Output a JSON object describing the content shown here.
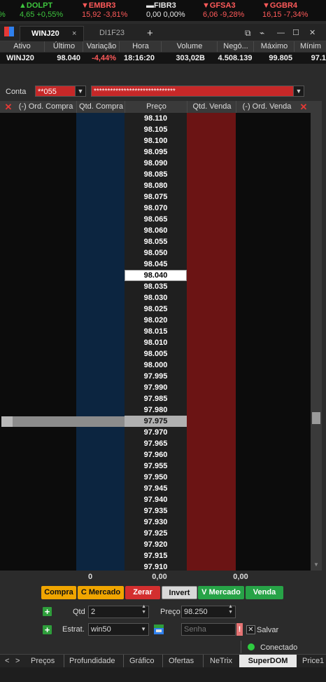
{
  "ticker": [
    {
      "arrow": "▲",
      "name": "DOLPT",
      "value": "4,65",
      "change": "+0,55%",
      "dir": "up",
      "prefix": "%"
    },
    {
      "arrow": "▼",
      "name": "EMBR3",
      "value": "15,92",
      "change": "-3,81%",
      "dir": "dn"
    },
    {
      "arrow": "▬",
      "name": "FIBR3",
      "value": "0,00",
      "change": "0,00%",
      "dir": "nt"
    },
    {
      "arrow": "▼",
      "name": "GFSA3",
      "value": "6,06",
      "change": "-9,28%",
      "dir": "dn"
    },
    {
      "arrow": "▼",
      "name": "GGBR4",
      "value": "16,15",
      "change": "-7,34%",
      "dir": "dn"
    }
  ],
  "tabs": {
    "active": "WINJ20",
    "other": "DI1F23",
    "close": "×",
    "add": "+"
  },
  "window_controls": {
    "detach": "⧉",
    "chart": "⌁",
    "minimize": "—",
    "maximize": "☐",
    "close": "✕"
  },
  "quote_headers": [
    "Ativo",
    "Último",
    "Variação",
    "Hora",
    "Volume",
    "Negó...",
    "Máximo",
    "Mínim"
  ],
  "quote_row": [
    "WINJ20",
    "98.040",
    "-4,44%",
    "18:16:20",
    "303,02B",
    "4.508.139",
    "99.805",
    "97.1"
  ],
  "conta": {
    "label": "Conta",
    "account": "**055",
    "name": "******************************"
  },
  "ladder_headers": {
    "ord_compra": "(-) Ord. Compra",
    "qtd_compra": "Qtd. Compra",
    "preco": "Preço",
    "qtd_venda": "Qtd. Venda",
    "ord_venda": "(-) Ord. Venda",
    "close": "✕"
  },
  "prices": [
    "98.110",
    "98.105",
    "98.100",
    "98.095",
    "98.090",
    "98.085",
    "98.080",
    "98.075",
    "98.070",
    "98.065",
    "98.060",
    "98.055",
    "98.050",
    "98.045",
    "98.040",
    "98.035",
    "98.030",
    "98.025",
    "98.020",
    "98.015",
    "98.010",
    "98.005",
    "98.000",
    "97.995",
    "97.990",
    "97.985",
    "97.980",
    "97.975",
    "97.970",
    "97.965",
    "97.960",
    "97.955",
    "97.950",
    "97.945",
    "97.940",
    "97.935",
    "97.930",
    "97.925",
    "97.920",
    "97.915",
    "97.910"
  ],
  "current_price": "98.040",
  "selected_price": "97.975",
  "totals": {
    "ord_compra": "0",
    "qtd_compra": "0,00",
    "qtd_venda": "0,00"
  },
  "buttons": {
    "compra": "Compra",
    "c_mercado": "C Mercado",
    "zerar": "Zerar",
    "invert": "Invert",
    "v_mercado": "V Mercado",
    "venda": "Venda"
  },
  "form": {
    "qtd_label": "Qtd",
    "qtd_value": "2",
    "preco_label": "Preço",
    "preco_value": "98.250",
    "estrat_label": "Estrat.",
    "estrat_value": "win50",
    "senha_placeholder": "Senha",
    "salvar_label": "Salvar",
    "alert": "!",
    "check": "✕"
  },
  "status": {
    "text": "Conectado",
    "color": "#2ecc40"
  },
  "bottom_tabs": [
    "Preços",
    "Profundidade",
    "Gráfico",
    "Ofertas",
    "NeTrix",
    "SuperDOM",
    "Price1"
  ],
  "bottom_active": "SuperDOM",
  "nav": {
    "prev": "<",
    "next": ">"
  }
}
